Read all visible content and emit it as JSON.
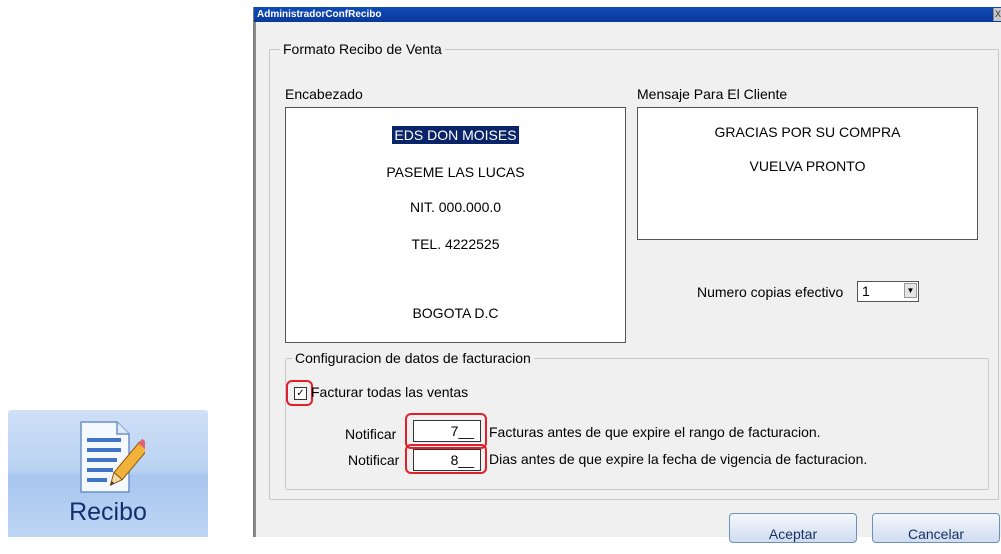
{
  "tile": {
    "label": "Recibo",
    "icon": "document-pencil-icon"
  },
  "window": {
    "title": "AdministradorConfRecibo",
    "close_glyph": "X"
  },
  "format_group": {
    "legend": "Formato Recibo de Venta",
    "header_label": "Encabezado",
    "header_lines": [
      "EDS DON MOISES",
      "PASEME LAS LUCAS",
      "NIT. 000.000.0",
      "TEL. 4222525",
      "BOGOTA D.C"
    ],
    "message_label": "Mensaje Para El Cliente",
    "message_lines": [
      "GRACIAS POR SU COMPRA",
      "VUELVA PRONTO"
    ],
    "copies_label": "Numero copias efectivo",
    "copies_value": "1"
  },
  "billing_group": {
    "legend": "Configuracion de datos de facturacion",
    "checkbox_label": "Facturar todas las ventas",
    "checkbox_checked": true,
    "notify_label": "Notificar",
    "invoices_value": "7__",
    "invoices_text": "Facturas antes de que expire el rango de facturacion.",
    "days_value": "8__",
    "days_text": "Dias antes de que expire la fecha de vigencia de facturacion."
  },
  "buttons": {
    "accept": "Aceptar",
    "cancel": "Cancelar"
  },
  "colors": {
    "highlight": "#e0202a",
    "titlebar": "#0e4bb8",
    "selection": "#0a246a"
  }
}
